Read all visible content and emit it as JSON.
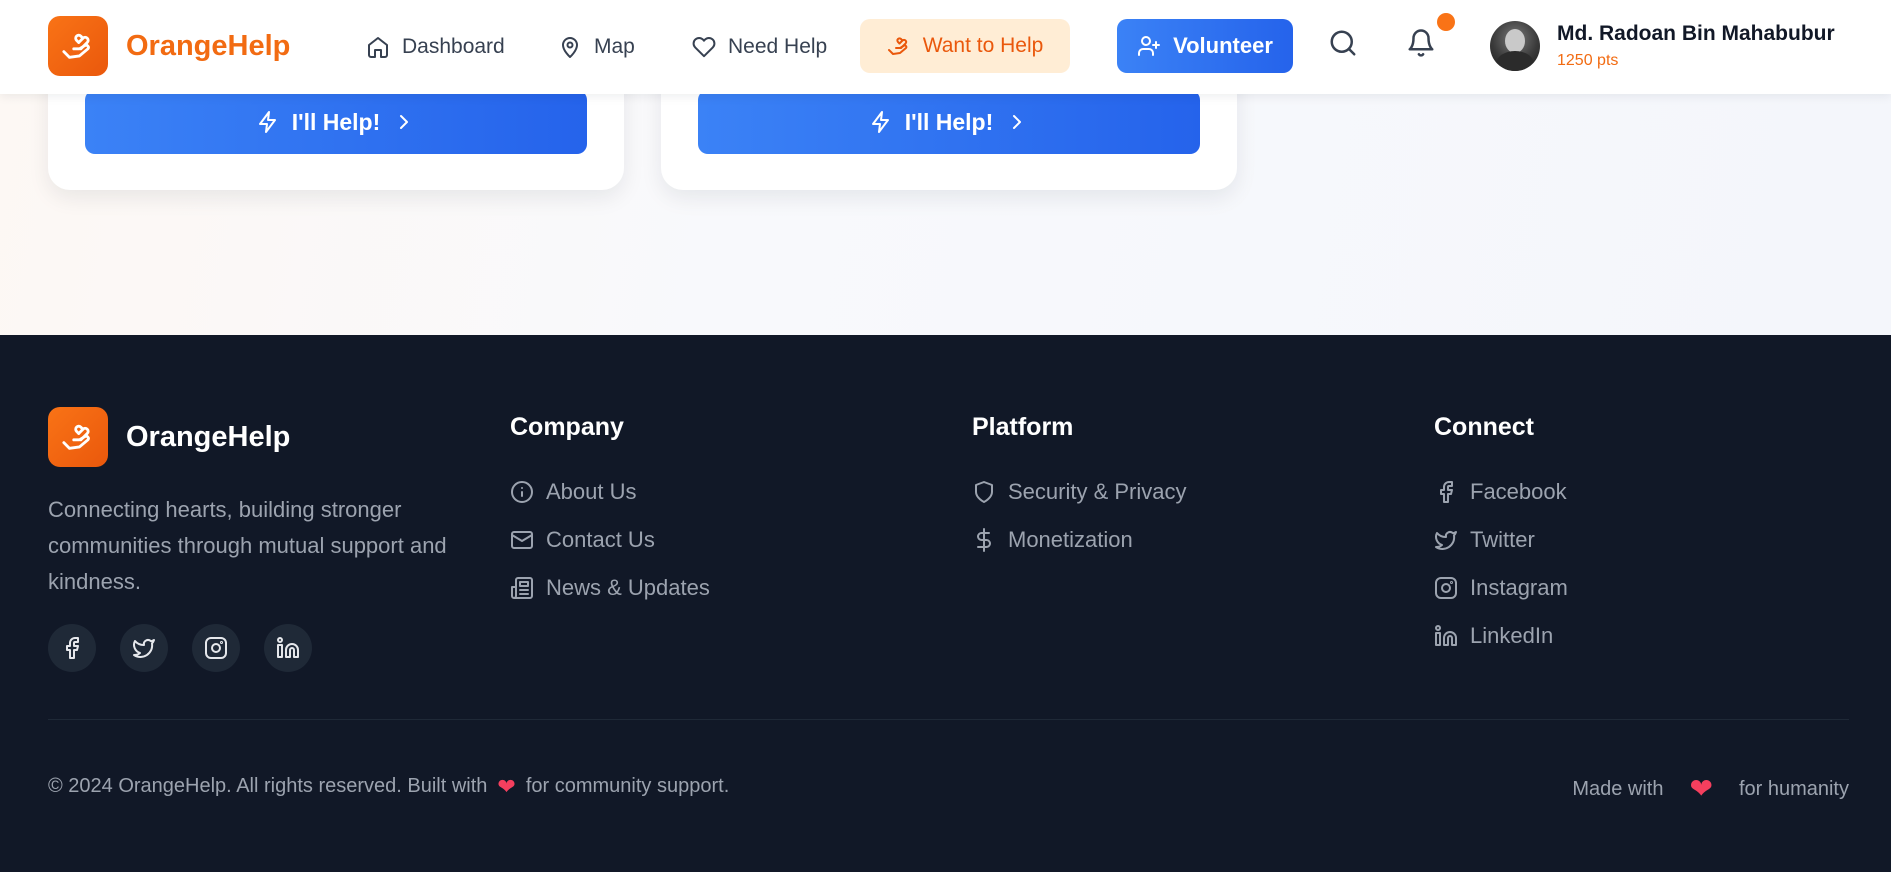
{
  "header": {
    "brand": "OrangeHelp",
    "nav": {
      "dashboard": "Dashboard",
      "map": "Map",
      "need_help": "Need Help",
      "want_to_help": "Want to Help"
    },
    "volunteer_label": "Volunteer",
    "user": {
      "name": "Md. Radoan Bin Mahabubur",
      "points": "1250 pts"
    }
  },
  "cards": [
    {
      "button_label": "I'll Help!"
    },
    {
      "button_label": "I'll Help!"
    }
  ],
  "footer": {
    "brand": "OrangeHelp",
    "tagline": "Connecting hearts, building stronger communities through mutual support and kindness.",
    "company": {
      "title": "Company",
      "links": [
        "About Us",
        "Contact Us",
        "News & Updates"
      ]
    },
    "platform": {
      "title": "Platform",
      "links": [
        "Security & Privacy",
        "Monetization"
      ]
    },
    "connect": {
      "title": "Connect",
      "links": [
        "Facebook",
        "Twitter",
        "Instagram",
        "LinkedIn"
      ]
    },
    "copyright_before": "© 2024 OrangeHelp. All rights reserved. Built with",
    "copyright_after": "for community support.",
    "made_with_before": "Made with",
    "made_with_after": "for humanity"
  },
  "colors": {
    "brand_orange": "#f26b12",
    "primary_blue": "#2563eb",
    "footer_bg": "#111827",
    "notification_dot": "#f97316",
    "heart": "#f43f5e"
  },
  "icons": {
    "logo": "hand-heart-icon",
    "dashboard": "home-icon",
    "map": "map-pin-icon",
    "need_help": "heart-icon",
    "want_to_help": "hand-heart-icon",
    "volunteer": "user-plus-icon",
    "search": "search-icon",
    "notifications": "bell-icon",
    "help_button": "zap-icon",
    "chevron": "chevron-right-icon"
  }
}
